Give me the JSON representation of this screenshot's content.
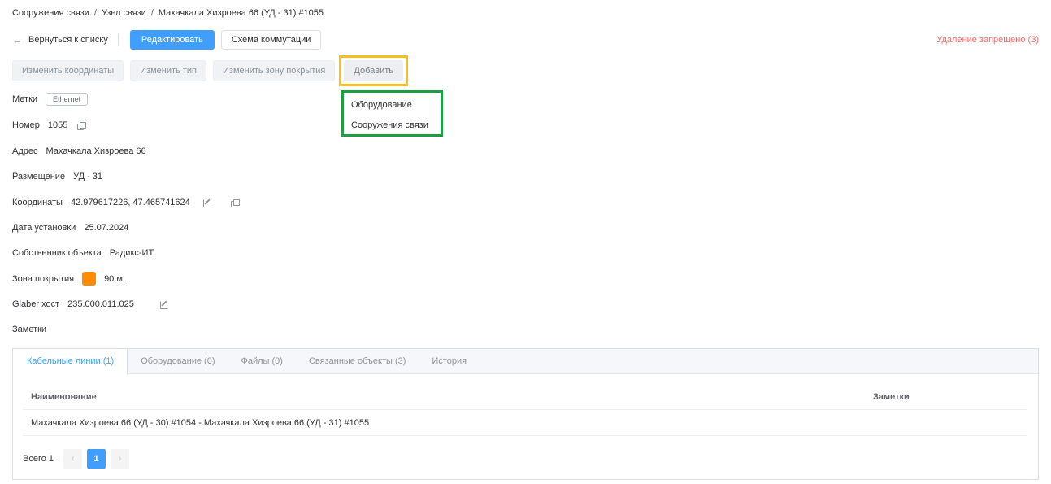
{
  "breadcrumb": [
    "Сооружения связи",
    "Узел связи",
    "Махачкала Хизроева 66 (УД - 31) #1055"
  ],
  "breadcrumb_sep": "/",
  "toolbar": {
    "back_label": "Вернуться к списку",
    "edit_label": "Редактировать",
    "scheme_label": "Схема коммутации",
    "delete_note": "Удаление запрещено (3)"
  },
  "actions": {
    "change_coords": "Изменить координаты",
    "change_type": "Изменить тип",
    "change_zone": "Изменить зону покрытия",
    "add": "Добавить"
  },
  "dropdown": {
    "items": [
      "Оборудование",
      "Сооружения связи"
    ]
  },
  "fields": {
    "tags_label": "Метки",
    "tag_value": "Ethernet",
    "number_label": "Номер",
    "number_value": "1055",
    "address_label": "Адрес",
    "address_value": "Махачкала Хизроева 66",
    "placement_label": "Размещение",
    "placement_value": "УД - 31",
    "coords_label": "Координаты",
    "coords_value": "42.979617226, 47.465741624",
    "install_date_label": "Дата установки",
    "install_date_value": "25.07.2024",
    "owner_label": "Собственник объекта",
    "owner_value": "Радикс-ИТ",
    "zone_label": "Зона покрытия",
    "zone_value": "90 м.",
    "zone_color": "#ff8c00",
    "glaber_label": "Glaber хост",
    "glaber_value": "235.000.011.025",
    "notes_label": "Заметки"
  },
  "tabs": [
    "Кабельные линии (1)",
    "Оборудование (0)",
    "Файлы (0)",
    "Связанные объекты (3)",
    "История"
  ],
  "table": {
    "columns": [
      "Наименование",
      "Заметки"
    ],
    "rows": [
      [
        "Махачкала Хизроева 66 (УД - 30) #1054 - Махачкала Хизроева 66 (УД - 31) #1055",
        ""
      ]
    ]
  },
  "pager": {
    "total": "Всего 1",
    "current": "1",
    "prev": "‹",
    "next": "›"
  },
  "colors": {
    "primary": "#409eff",
    "danger": "#f56c6c",
    "highlight_yellow": "#f7c01a",
    "highlight_green": "#1e9e44"
  }
}
